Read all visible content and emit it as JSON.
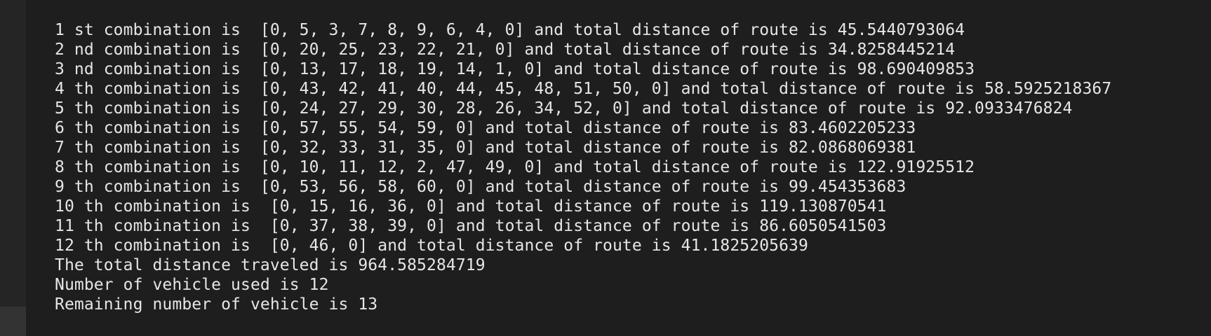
{
  "console": {
    "lines": [
      "1 st combination is  [0, 5, 3, 7, 8, 9, 6, 4, 0] and total distance of route is 45.5440793064",
      "2 nd combination is  [0, 20, 25, 23, 22, 21, 0] and total distance of route is 34.8258445214",
      "3 nd combination is  [0, 13, 17, 18, 19, 14, 1, 0] and total distance of route is 98.690409853",
      "4 th combination is  [0, 43, 42, 41, 40, 44, 45, 48, 51, 50, 0] and total distance of route is 58.5925218367",
      "5 th combination is  [0, 24, 27, 29, 30, 28, 26, 34, 52, 0] and total distance of route is 92.0933476824",
      "6 th combination is  [0, 57, 55, 54, 59, 0] and total distance of route is 83.4602205233",
      "7 th combination is  [0, 32, 33, 31, 35, 0] and total distance of route is 82.0868069381",
      "8 th combination is  [0, 10, 11, 12, 2, 47, 49, 0] and total distance of route is 122.91925512",
      "9 th combination is  [0, 53, 56, 58, 60, 0] and total distance of route is 99.454353683",
      "10 th combination is  [0, 15, 16, 36, 0] and total distance of route is 119.130870541",
      "11 th combination is  [0, 37, 38, 39, 0] and total distance of route is 86.6050541503",
      "12 th combination is  [0, 46, 0] and total distance of route is 41.1825205639",
      "The total distance traveled is 964.585284719",
      "Number of vehicle used is 12",
      "Remaining number of vehicle is 13"
    ]
  }
}
